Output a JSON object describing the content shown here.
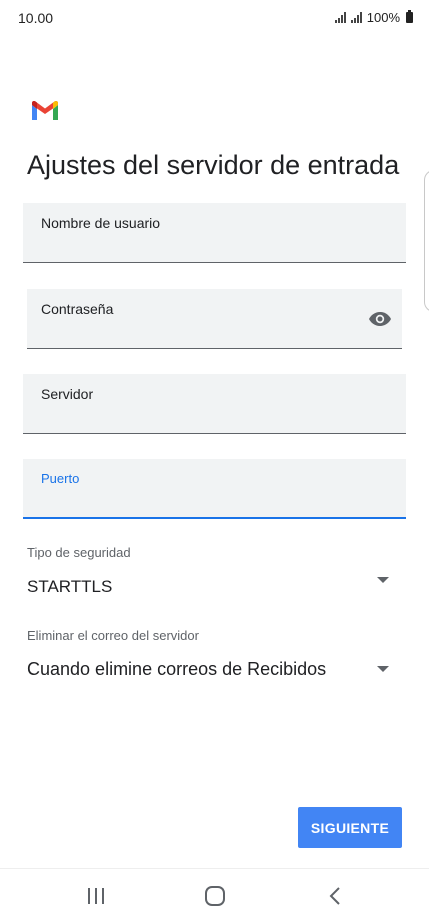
{
  "status_bar": {
    "time": "10.00",
    "battery_text": "100%"
  },
  "logo": {
    "icon": "gmail-logo-icon"
  },
  "page_title": "Ajustes del servidor de entrada",
  "fields": {
    "username_label": "Nombre de usuario",
    "password_label": "Contraseña",
    "server_label": "Servidor",
    "port_label": "Puerto"
  },
  "security": {
    "label": "Tipo de seguridad",
    "value": "STARTTLS"
  },
  "delete_mail": {
    "label": "Eliminar el correo del servidor",
    "value": "Cuando elimine correos de Recibidos"
  },
  "actions": {
    "next_label": "SIGUIENTE"
  },
  "colors": {
    "accent": "#1a73e8",
    "button": "#4285f4",
    "field_bg": "#f1f3f4"
  }
}
